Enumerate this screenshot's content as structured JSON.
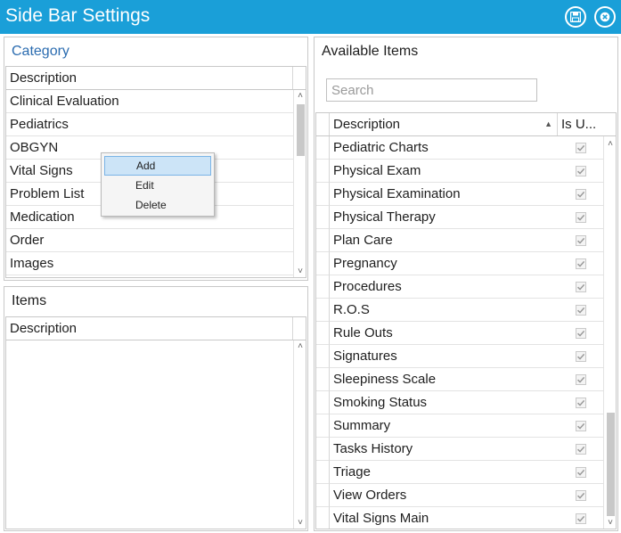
{
  "window": {
    "title": "Side Bar Settings",
    "title_bar_color": "#1a9fd8",
    "buttons": [
      {
        "icon": "save-icon"
      },
      {
        "icon": "close-icon"
      }
    ]
  },
  "category_panel": {
    "title": "Category",
    "title_color": "#2b6cb0",
    "column_header": "Description",
    "rows": [
      "Clinical Evaluation",
      "Pediatrics",
      "OBGYN",
      "Vital Signs",
      "Problem List",
      "Medication",
      "Order",
      "Images"
    ]
  },
  "context_menu": {
    "items": [
      "Add",
      "Edit",
      "Delete"
    ],
    "highlighted": "Add"
  },
  "items_panel": {
    "title": "Items",
    "column_header": "Description",
    "rows": []
  },
  "available_panel": {
    "title": "Available Items",
    "search_placeholder": "Search",
    "columns": [
      "Description",
      "Is U..."
    ],
    "sort_indicator": "▲",
    "rows": [
      {
        "description": "Pediatric Charts",
        "is_used": true
      },
      {
        "description": "Physical Exam",
        "is_used": true
      },
      {
        "description": "Physical Examination",
        "is_used": true
      },
      {
        "description": "Physical Therapy",
        "is_used": true
      },
      {
        "description": "Plan Care",
        "is_used": true
      },
      {
        "description": "Pregnancy",
        "is_used": true
      },
      {
        "description": "Procedures",
        "is_used": true
      },
      {
        "description": "R.O.S",
        "is_used": true
      },
      {
        "description": "Rule Outs",
        "is_used": true
      },
      {
        "description": "Signatures",
        "is_used": true
      },
      {
        "description": "Sleepiness Scale",
        "is_used": true
      },
      {
        "description": "Smoking Status",
        "is_used": true
      },
      {
        "description": "Summary",
        "is_used": true
      },
      {
        "description": "Tasks History",
        "is_used": true
      },
      {
        "description": "Triage",
        "is_used": true
      },
      {
        "description": "View Orders",
        "is_used": true
      },
      {
        "description": "Vital Signs Main",
        "is_used": true
      }
    ]
  }
}
